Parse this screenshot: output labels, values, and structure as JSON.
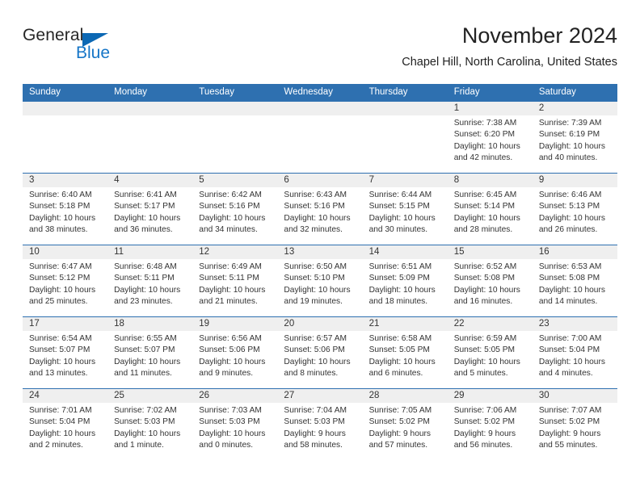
{
  "brand": {
    "name_top": "General",
    "name_bottom": "Blue",
    "accent_color": "#1575c7",
    "triangle_color": "#0c68b4"
  },
  "header": {
    "title": "November 2024",
    "subtitle": "Chapel Hill, North Carolina, United States"
  },
  "theme": {
    "header_blue": "#2e70b0",
    "date_band_gray": "#efefef",
    "text_color": "#333333"
  },
  "weekdays": [
    "Sunday",
    "Monday",
    "Tuesday",
    "Wednesday",
    "Thursday",
    "Friday",
    "Saturday"
  ],
  "weeks": [
    [
      {
        "day": "",
        "sunrise": "",
        "sunset": "",
        "daylight_1": "",
        "daylight_2": ""
      },
      {
        "day": "",
        "sunrise": "",
        "sunset": "",
        "daylight_1": "",
        "daylight_2": ""
      },
      {
        "day": "",
        "sunrise": "",
        "sunset": "",
        "daylight_1": "",
        "daylight_2": ""
      },
      {
        "day": "",
        "sunrise": "",
        "sunset": "",
        "daylight_1": "",
        "daylight_2": ""
      },
      {
        "day": "",
        "sunrise": "",
        "sunset": "",
        "daylight_1": "",
        "daylight_2": ""
      },
      {
        "day": "1",
        "sunrise": "Sunrise: 7:38 AM",
        "sunset": "Sunset: 6:20 PM",
        "daylight_1": "Daylight: 10 hours",
        "daylight_2": "and 42 minutes."
      },
      {
        "day": "2",
        "sunrise": "Sunrise: 7:39 AM",
        "sunset": "Sunset: 6:19 PM",
        "daylight_1": "Daylight: 10 hours",
        "daylight_2": "and 40 minutes."
      }
    ],
    [
      {
        "day": "3",
        "sunrise": "Sunrise: 6:40 AM",
        "sunset": "Sunset: 5:18 PM",
        "daylight_1": "Daylight: 10 hours",
        "daylight_2": "and 38 minutes."
      },
      {
        "day": "4",
        "sunrise": "Sunrise: 6:41 AM",
        "sunset": "Sunset: 5:17 PM",
        "daylight_1": "Daylight: 10 hours",
        "daylight_2": "and 36 minutes."
      },
      {
        "day": "5",
        "sunrise": "Sunrise: 6:42 AM",
        "sunset": "Sunset: 5:16 PM",
        "daylight_1": "Daylight: 10 hours",
        "daylight_2": "and 34 minutes."
      },
      {
        "day": "6",
        "sunrise": "Sunrise: 6:43 AM",
        "sunset": "Sunset: 5:16 PM",
        "daylight_1": "Daylight: 10 hours",
        "daylight_2": "and 32 minutes."
      },
      {
        "day": "7",
        "sunrise": "Sunrise: 6:44 AM",
        "sunset": "Sunset: 5:15 PM",
        "daylight_1": "Daylight: 10 hours",
        "daylight_2": "and 30 minutes."
      },
      {
        "day": "8",
        "sunrise": "Sunrise: 6:45 AM",
        "sunset": "Sunset: 5:14 PM",
        "daylight_1": "Daylight: 10 hours",
        "daylight_2": "and 28 minutes."
      },
      {
        "day": "9",
        "sunrise": "Sunrise: 6:46 AM",
        "sunset": "Sunset: 5:13 PM",
        "daylight_1": "Daylight: 10 hours",
        "daylight_2": "and 26 minutes."
      }
    ],
    [
      {
        "day": "10",
        "sunrise": "Sunrise: 6:47 AM",
        "sunset": "Sunset: 5:12 PM",
        "daylight_1": "Daylight: 10 hours",
        "daylight_2": "and 25 minutes."
      },
      {
        "day": "11",
        "sunrise": "Sunrise: 6:48 AM",
        "sunset": "Sunset: 5:11 PM",
        "daylight_1": "Daylight: 10 hours",
        "daylight_2": "and 23 minutes."
      },
      {
        "day": "12",
        "sunrise": "Sunrise: 6:49 AM",
        "sunset": "Sunset: 5:11 PM",
        "daylight_1": "Daylight: 10 hours",
        "daylight_2": "and 21 minutes."
      },
      {
        "day": "13",
        "sunrise": "Sunrise: 6:50 AM",
        "sunset": "Sunset: 5:10 PM",
        "daylight_1": "Daylight: 10 hours",
        "daylight_2": "and 19 minutes."
      },
      {
        "day": "14",
        "sunrise": "Sunrise: 6:51 AM",
        "sunset": "Sunset: 5:09 PM",
        "daylight_1": "Daylight: 10 hours",
        "daylight_2": "and 18 minutes."
      },
      {
        "day": "15",
        "sunrise": "Sunrise: 6:52 AM",
        "sunset": "Sunset: 5:08 PM",
        "daylight_1": "Daylight: 10 hours",
        "daylight_2": "and 16 minutes."
      },
      {
        "day": "16",
        "sunrise": "Sunrise: 6:53 AM",
        "sunset": "Sunset: 5:08 PM",
        "daylight_1": "Daylight: 10 hours",
        "daylight_2": "and 14 minutes."
      }
    ],
    [
      {
        "day": "17",
        "sunrise": "Sunrise: 6:54 AM",
        "sunset": "Sunset: 5:07 PM",
        "daylight_1": "Daylight: 10 hours",
        "daylight_2": "and 13 minutes."
      },
      {
        "day": "18",
        "sunrise": "Sunrise: 6:55 AM",
        "sunset": "Sunset: 5:07 PM",
        "daylight_1": "Daylight: 10 hours",
        "daylight_2": "and 11 minutes."
      },
      {
        "day": "19",
        "sunrise": "Sunrise: 6:56 AM",
        "sunset": "Sunset: 5:06 PM",
        "daylight_1": "Daylight: 10 hours",
        "daylight_2": "and 9 minutes."
      },
      {
        "day": "20",
        "sunrise": "Sunrise: 6:57 AM",
        "sunset": "Sunset: 5:06 PM",
        "daylight_1": "Daylight: 10 hours",
        "daylight_2": "and 8 minutes."
      },
      {
        "day": "21",
        "sunrise": "Sunrise: 6:58 AM",
        "sunset": "Sunset: 5:05 PM",
        "daylight_1": "Daylight: 10 hours",
        "daylight_2": "and 6 minutes."
      },
      {
        "day": "22",
        "sunrise": "Sunrise: 6:59 AM",
        "sunset": "Sunset: 5:05 PM",
        "daylight_1": "Daylight: 10 hours",
        "daylight_2": "and 5 minutes."
      },
      {
        "day": "23",
        "sunrise": "Sunrise: 7:00 AM",
        "sunset": "Sunset: 5:04 PM",
        "daylight_1": "Daylight: 10 hours",
        "daylight_2": "and 4 minutes."
      }
    ],
    [
      {
        "day": "24",
        "sunrise": "Sunrise: 7:01 AM",
        "sunset": "Sunset: 5:04 PM",
        "daylight_1": "Daylight: 10 hours",
        "daylight_2": "and 2 minutes."
      },
      {
        "day": "25",
        "sunrise": "Sunrise: 7:02 AM",
        "sunset": "Sunset: 5:03 PM",
        "daylight_1": "Daylight: 10 hours",
        "daylight_2": "and 1 minute."
      },
      {
        "day": "26",
        "sunrise": "Sunrise: 7:03 AM",
        "sunset": "Sunset: 5:03 PM",
        "daylight_1": "Daylight: 10 hours",
        "daylight_2": "and 0 minutes."
      },
      {
        "day": "27",
        "sunrise": "Sunrise: 7:04 AM",
        "sunset": "Sunset: 5:03 PM",
        "daylight_1": "Daylight: 9 hours",
        "daylight_2": "and 58 minutes."
      },
      {
        "day": "28",
        "sunrise": "Sunrise: 7:05 AM",
        "sunset": "Sunset: 5:02 PM",
        "daylight_1": "Daylight: 9 hours",
        "daylight_2": "and 57 minutes."
      },
      {
        "day": "29",
        "sunrise": "Sunrise: 7:06 AM",
        "sunset": "Sunset: 5:02 PM",
        "daylight_1": "Daylight: 9 hours",
        "daylight_2": "and 56 minutes."
      },
      {
        "day": "30",
        "sunrise": "Sunrise: 7:07 AM",
        "sunset": "Sunset: 5:02 PM",
        "daylight_1": "Daylight: 9 hours",
        "daylight_2": "and 55 minutes."
      }
    ]
  ]
}
